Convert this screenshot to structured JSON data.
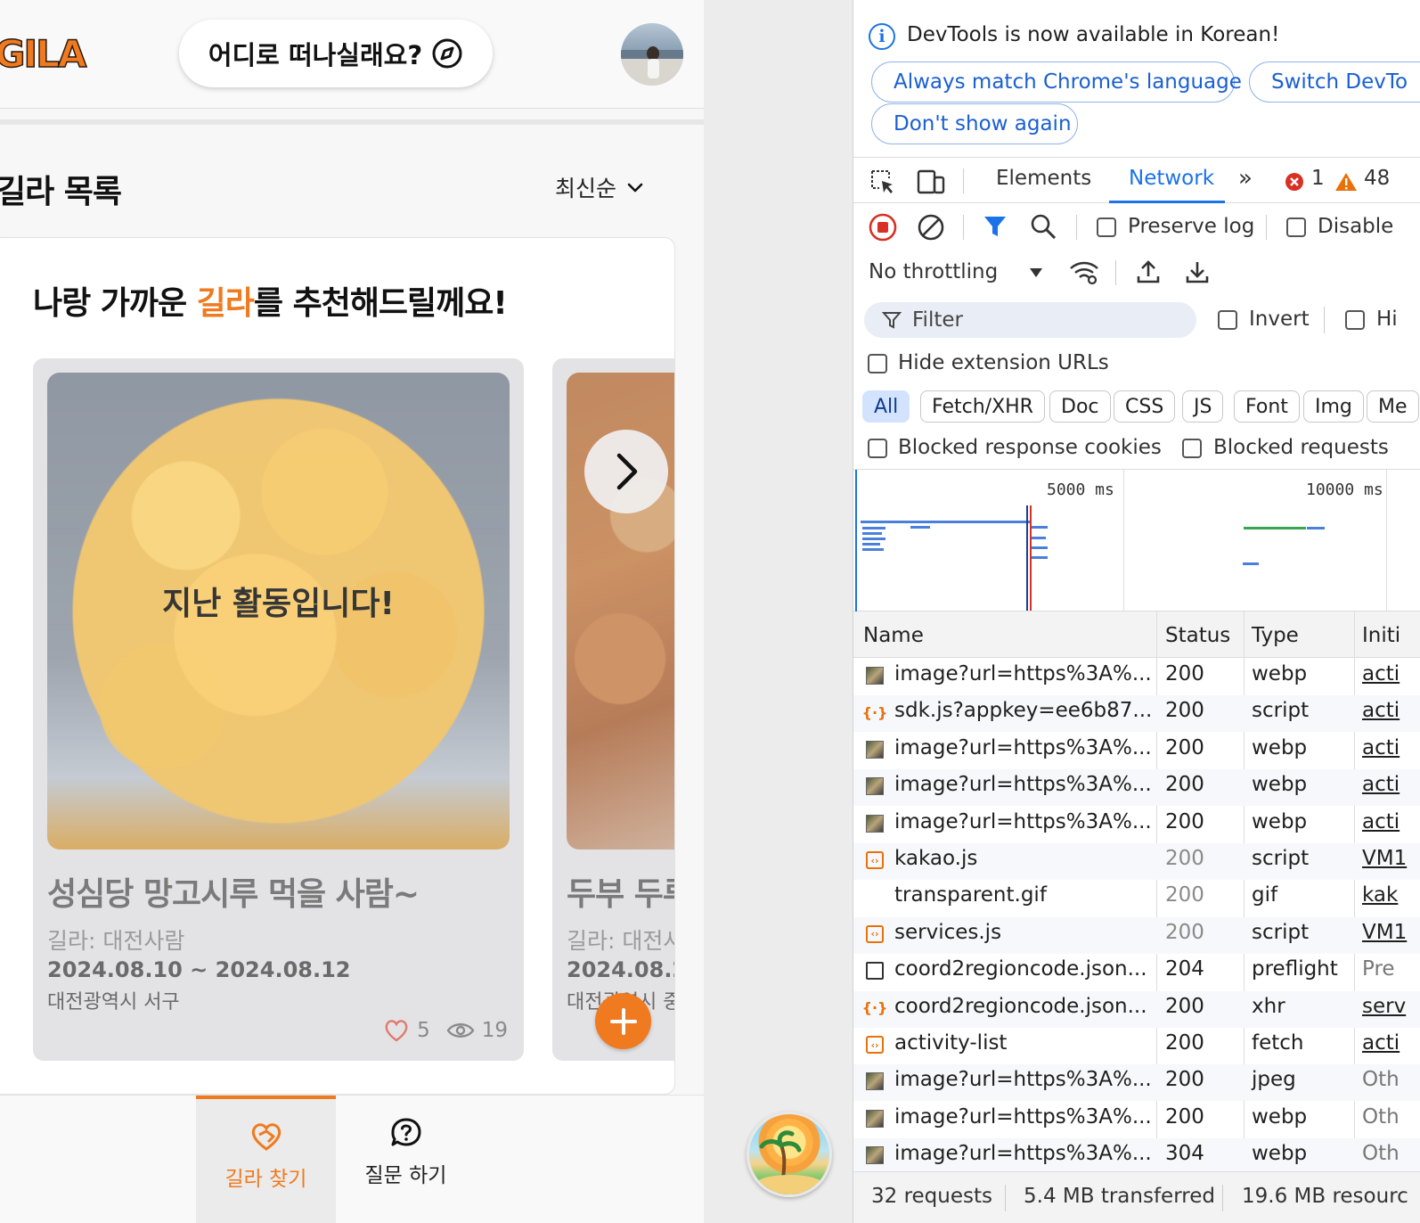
{
  "app": {
    "logo_text": "GILA",
    "search_prompt": "어디로 떠나실래요?",
    "list_title": "길라 목록",
    "sort_label": "최신순",
    "recommend_prefix": "나랑 가까운 ",
    "recommend_highlight": "길라",
    "recommend_suffix": "를 추천해드릴께요!",
    "cards": [
      {
        "overlay": "지난 활동입니다!",
        "title": "성심당 망고시루 먹을 사람~",
        "host": "길라: 대전사람",
        "date": "2024.08.10 ~ 2024.08.12",
        "region": "대전광역시 서구",
        "likes": "5",
        "views": "19"
      },
      {
        "title": "두부 두루",
        "host": "길라: 대전사",
        "date": "2024.08.2",
        "region": "대전광역시 중"
      }
    ],
    "nav": [
      {
        "label": "길라 찾기",
        "active": true
      },
      {
        "label": "질문 하기",
        "active": false
      }
    ],
    "accent_color": "#f07a1f"
  },
  "devtools": {
    "info_message": "DevTools is now available in Korean!",
    "info_buttons": [
      "Always match Chrome's language",
      "Switch DevTo",
      "Don't show again"
    ],
    "tabs": [
      "Elements",
      "Network"
    ],
    "active_tab": "Network",
    "error_count": "1",
    "warning_count": "48",
    "preserve_log": "Preserve log",
    "disable_cache": "Disable",
    "throttling": "No throttling",
    "filter_placeholder": "Filter",
    "invert": "Invert",
    "hide_data": "Hi",
    "hide_extension": "Hide extension URLs",
    "type_filters": [
      "All",
      "Fetch/XHR",
      "Doc",
      "CSS",
      "JS",
      "Font",
      "Img",
      "Me"
    ],
    "blocked_cookies": "Blocked response cookies",
    "blocked_requests": "Blocked requests",
    "timeline_labels": [
      "5000 ms",
      "10000 ms"
    ],
    "columns": [
      "Name",
      "Status",
      "Type",
      "Initi"
    ],
    "rows": [
      {
        "icon": "img",
        "name": "image?url=https%3A%...",
        "status": "200",
        "type": "webp",
        "init": "acti",
        "dim": false,
        "plain": false
      },
      {
        "icon": "xhr",
        "name": "sdk.js?appkey=ee6b87...",
        "status": "200",
        "type": "script",
        "init": "acti",
        "dim": false,
        "plain": false
      },
      {
        "icon": "img",
        "name": "image?url=https%3A%...",
        "status": "200",
        "type": "webp",
        "init": "acti",
        "dim": false,
        "plain": false
      },
      {
        "icon": "img",
        "name": "image?url=https%3A%...",
        "status": "200",
        "type": "webp",
        "init": "acti",
        "dim": false,
        "plain": false
      },
      {
        "icon": "img",
        "name": "image?url=https%3A%...",
        "status": "200",
        "type": "webp",
        "init": "acti",
        "dim": false,
        "plain": false
      },
      {
        "icon": "script",
        "name": "kakao.js",
        "status": "200",
        "type": "script",
        "init": "VM1",
        "dim": true,
        "plain": false
      },
      {
        "icon": "none",
        "name": "transparent.gif",
        "status": "200",
        "type": "gif",
        "init": "kak",
        "dim": true,
        "plain": false
      },
      {
        "icon": "script",
        "name": "services.js",
        "status": "200",
        "type": "script",
        "init": "VM1",
        "dim": true,
        "plain": false
      },
      {
        "icon": "doc",
        "name": "coord2regioncode.json...",
        "status": "204",
        "type": "preflight",
        "init": "Pre",
        "dim": false,
        "plain": true
      },
      {
        "icon": "xhr",
        "name": "coord2regioncode.json...",
        "status": "200",
        "type": "xhr",
        "init": "serv",
        "dim": false,
        "plain": false
      },
      {
        "icon": "script",
        "name": "activity-list",
        "status": "200",
        "type": "fetch",
        "init": "acti",
        "dim": false,
        "plain": false
      },
      {
        "icon": "img",
        "name": "image?url=https%3A%...",
        "status": "200",
        "type": "jpeg",
        "init": "Oth",
        "dim": false,
        "plain": true
      },
      {
        "icon": "img",
        "name": "image?url=https%3A%...",
        "status": "200",
        "type": "webp",
        "init": "Oth",
        "dim": false,
        "plain": true
      },
      {
        "icon": "img",
        "name": "image?url=https%3A%...",
        "status": "304",
        "type": "webp",
        "init": "Oth",
        "dim": false,
        "plain": true
      }
    ],
    "summary": [
      "32 requests",
      "5.4 MB transferred",
      "19.6 MB resourc"
    ]
  }
}
